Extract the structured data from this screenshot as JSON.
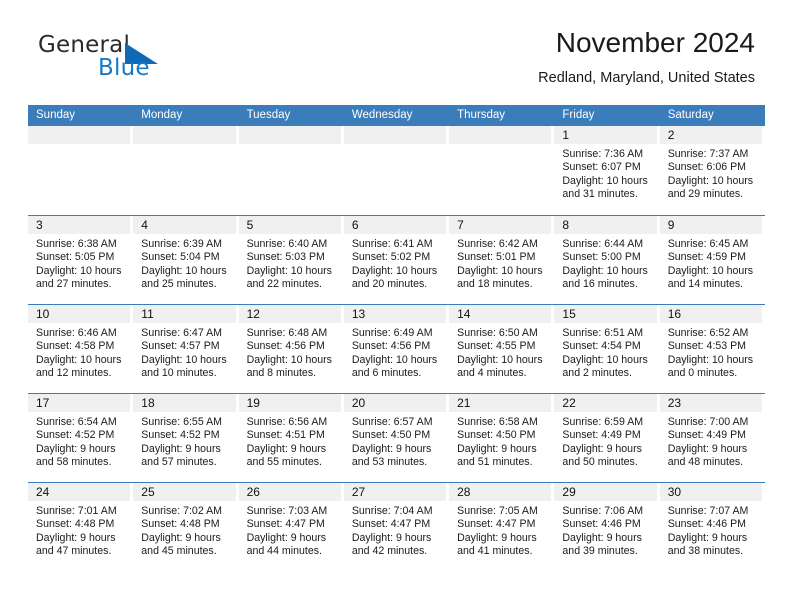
{
  "brand": {
    "name_top": "General",
    "name_bottom": "Blue",
    "accent_color": "#1069b4",
    "text_color": "#2b2b2b"
  },
  "header": {
    "title": "November 2024",
    "location": "Redland, Maryland, United States"
  },
  "calendar": {
    "header_bg": "#3b7cbb",
    "daynum_bg": "#f0f0f0",
    "weekdays": [
      "Sunday",
      "Monday",
      "Tuesday",
      "Wednesday",
      "Thursday",
      "Friday",
      "Saturday"
    ],
    "weeks": [
      [
        {
          "day": "",
          "sunrise": "",
          "sunset": "",
          "daylight": ""
        },
        {
          "day": "",
          "sunrise": "",
          "sunset": "",
          "daylight": ""
        },
        {
          "day": "",
          "sunrise": "",
          "sunset": "",
          "daylight": ""
        },
        {
          "day": "",
          "sunrise": "",
          "sunset": "",
          "daylight": ""
        },
        {
          "day": "",
          "sunrise": "",
          "sunset": "",
          "daylight": ""
        },
        {
          "day": "1",
          "sunrise": "Sunrise: 7:36 AM",
          "sunset": "Sunset: 6:07 PM",
          "daylight": "Daylight: 10 hours and 31 minutes."
        },
        {
          "day": "2",
          "sunrise": "Sunrise: 7:37 AM",
          "sunset": "Sunset: 6:06 PM",
          "daylight": "Daylight: 10 hours and 29 minutes."
        }
      ],
      [
        {
          "day": "3",
          "sunrise": "Sunrise: 6:38 AM",
          "sunset": "Sunset: 5:05 PM",
          "daylight": "Daylight: 10 hours and 27 minutes."
        },
        {
          "day": "4",
          "sunrise": "Sunrise: 6:39 AM",
          "sunset": "Sunset: 5:04 PM",
          "daylight": "Daylight: 10 hours and 25 minutes."
        },
        {
          "day": "5",
          "sunrise": "Sunrise: 6:40 AM",
          "sunset": "Sunset: 5:03 PM",
          "daylight": "Daylight: 10 hours and 22 minutes."
        },
        {
          "day": "6",
          "sunrise": "Sunrise: 6:41 AM",
          "sunset": "Sunset: 5:02 PM",
          "daylight": "Daylight: 10 hours and 20 minutes."
        },
        {
          "day": "7",
          "sunrise": "Sunrise: 6:42 AM",
          "sunset": "Sunset: 5:01 PM",
          "daylight": "Daylight: 10 hours and 18 minutes."
        },
        {
          "day": "8",
          "sunrise": "Sunrise: 6:44 AM",
          "sunset": "Sunset: 5:00 PM",
          "daylight": "Daylight: 10 hours and 16 minutes."
        },
        {
          "day": "9",
          "sunrise": "Sunrise: 6:45 AM",
          "sunset": "Sunset: 4:59 PM",
          "daylight": "Daylight: 10 hours and 14 minutes."
        }
      ],
      [
        {
          "day": "10",
          "sunrise": "Sunrise: 6:46 AM",
          "sunset": "Sunset: 4:58 PM",
          "daylight": "Daylight: 10 hours and 12 minutes."
        },
        {
          "day": "11",
          "sunrise": "Sunrise: 6:47 AM",
          "sunset": "Sunset: 4:57 PM",
          "daylight": "Daylight: 10 hours and 10 minutes."
        },
        {
          "day": "12",
          "sunrise": "Sunrise: 6:48 AM",
          "sunset": "Sunset: 4:56 PM",
          "daylight": "Daylight: 10 hours and 8 minutes."
        },
        {
          "day": "13",
          "sunrise": "Sunrise: 6:49 AM",
          "sunset": "Sunset: 4:56 PM",
          "daylight": "Daylight: 10 hours and 6 minutes."
        },
        {
          "day": "14",
          "sunrise": "Sunrise: 6:50 AM",
          "sunset": "Sunset: 4:55 PM",
          "daylight": "Daylight: 10 hours and 4 minutes."
        },
        {
          "day": "15",
          "sunrise": "Sunrise: 6:51 AM",
          "sunset": "Sunset: 4:54 PM",
          "daylight": "Daylight: 10 hours and 2 minutes."
        },
        {
          "day": "16",
          "sunrise": "Sunrise: 6:52 AM",
          "sunset": "Sunset: 4:53 PM",
          "daylight": "Daylight: 10 hours and 0 minutes."
        }
      ],
      [
        {
          "day": "17",
          "sunrise": "Sunrise: 6:54 AM",
          "sunset": "Sunset: 4:52 PM",
          "daylight": "Daylight: 9 hours and 58 minutes."
        },
        {
          "day": "18",
          "sunrise": "Sunrise: 6:55 AM",
          "sunset": "Sunset: 4:52 PM",
          "daylight": "Daylight: 9 hours and 57 minutes."
        },
        {
          "day": "19",
          "sunrise": "Sunrise: 6:56 AM",
          "sunset": "Sunset: 4:51 PM",
          "daylight": "Daylight: 9 hours and 55 minutes."
        },
        {
          "day": "20",
          "sunrise": "Sunrise: 6:57 AM",
          "sunset": "Sunset: 4:50 PM",
          "daylight": "Daylight: 9 hours and 53 minutes."
        },
        {
          "day": "21",
          "sunrise": "Sunrise: 6:58 AM",
          "sunset": "Sunset: 4:50 PM",
          "daylight": "Daylight: 9 hours and 51 minutes."
        },
        {
          "day": "22",
          "sunrise": "Sunrise: 6:59 AM",
          "sunset": "Sunset: 4:49 PM",
          "daylight": "Daylight: 9 hours and 50 minutes."
        },
        {
          "day": "23",
          "sunrise": "Sunrise: 7:00 AM",
          "sunset": "Sunset: 4:49 PM",
          "daylight": "Daylight: 9 hours and 48 minutes."
        }
      ],
      [
        {
          "day": "24",
          "sunrise": "Sunrise: 7:01 AM",
          "sunset": "Sunset: 4:48 PM",
          "daylight": "Daylight: 9 hours and 47 minutes."
        },
        {
          "day": "25",
          "sunrise": "Sunrise: 7:02 AM",
          "sunset": "Sunset: 4:48 PM",
          "daylight": "Daylight: 9 hours and 45 minutes."
        },
        {
          "day": "26",
          "sunrise": "Sunrise: 7:03 AM",
          "sunset": "Sunset: 4:47 PM",
          "daylight": "Daylight: 9 hours and 44 minutes."
        },
        {
          "day": "27",
          "sunrise": "Sunrise: 7:04 AM",
          "sunset": "Sunset: 4:47 PM",
          "daylight": "Daylight: 9 hours and 42 minutes."
        },
        {
          "day": "28",
          "sunrise": "Sunrise: 7:05 AM",
          "sunset": "Sunset: 4:47 PM",
          "daylight": "Daylight: 9 hours and 41 minutes."
        },
        {
          "day": "29",
          "sunrise": "Sunrise: 7:06 AM",
          "sunset": "Sunset: 4:46 PM",
          "daylight": "Daylight: 9 hours and 39 minutes."
        },
        {
          "day": "30",
          "sunrise": "Sunrise: 7:07 AM",
          "sunset": "Sunset: 4:46 PM",
          "daylight": "Daylight: 9 hours and 38 minutes."
        }
      ]
    ]
  }
}
